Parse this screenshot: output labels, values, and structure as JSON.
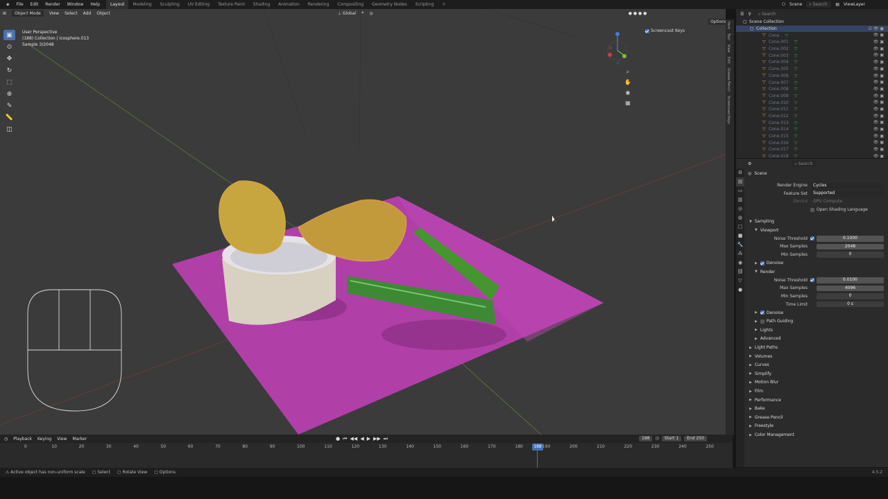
{
  "menu": [
    "File",
    "Edit",
    "Render",
    "Window",
    "Help"
  ],
  "workspaces": [
    "Layout",
    "Modeling",
    "Sculpting",
    "UV Editing",
    "Texture Paint",
    "Shading",
    "Animation",
    "Rendering",
    "Compositing",
    "Geometry Nodes",
    "Scripting"
  ],
  "active_workspace": "Layout",
  "topbar": {
    "scene": "Scene",
    "viewlayer": "ViewLayer",
    "search_placeholder": "Search"
  },
  "viewport": {
    "mode": "Object Mode",
    "menus": [
      "View",
      "Select",
      "Add",
      "Object"
    ],
    "orientation": "Global",
    "options": "Options",
    "perspective": "User Perspective",
    "collection": "(188) Collection | Icosphere.013",
    "sample": "Sample 3/2048",
    "screencast_keys": "Screencast Keys",
    "side_tabs": [
      "Item",
      "Tool",
      "View",
      "Edit",
      "Grease Pencil",
      "Screencast Keys"
    ]
  },
  "outliner": {
    "scene_collection": "Scene Collection",
    "collection": "Collection",
    "items": [
      "Cone",
      "Cone.001",
      "Cone.002",
      "Cone.003",
      "Cone.004",
      "Cone.005",
      "Cone.006",
      "Cone.007",
      "Cone.008",
      "Cone.009",
      "Cone.010",
      "Cone.011",
      "Cone.012",
      "Cone.013",
      "Cone.014",
      "Cone.015",
      "Cone.016",
      "Cone.017",
      "Cone.018"
    ]
  },
  "properties": {
    "context": "Scene",
    "search_placeholder": "Search",
    "render_engine": {
      "label": "Render Engine",
      "value": "Cycles"
    },
    "feature_set": {
      "label": "Feature Set",
      "value": "Supported"
    },
    "device": {
      "label": "Device",
      "value": "GPU Compute"
    },
    "osl": "Open Shading Language",
    "sampling": "Sampling",
    "viewport": "Viewport",
    "vp_noise_threshold": {
      "label": "Noise Threshold",
      "value": "0.1000"
    },
    "vp_max_samples": {
      "label": "Max Samples",
      "value": "2048"
    },
    "vp_min_samples": {
      "label": "Min Samples",
      "value": "0"
    },
    "denoise1": "Denoise",
    "render": "Render",
    "r_noise_threshold": {
      "label": "Noise Threshold",
      "value": "0.0100"
    },
    "r_max_samples": {
      "label": "Max Samples",
      "value": "4096"
    },
    "r_min_samples": {
      "label": "Min Samples",
      "value": "0"
    },
    "r_time_limit": {
      "label": "Time Limit",
      "value": "0 s"
    },
    "denoise2": "Denoise",
    "path_guiding": "Path Guiding",
    "lights": "Lights",
    "advanced": "Advanced",
    "sections": [
      "Light Paths",
      "Volumes",
      "Curves",
      "Simplify",
      "Motion Blur",
      "Film",
      "Performance",
      "Bake",
      "Grease Pencil",
      "Freestyle",
      "Color Management"
    ]
  },
  "timeline": {
    "menus": [
      "Playback",
      "Keying",
      "View",
      "Marker"
    ],
    "current_frame": "188",
    "start_label": "Start",
    "start": "1",
    "end_label": "End",
    "end": "250",
    "ticks": [
      "0",
      "10",
      "20",
      "30",
      "40",
      "50",
      "60",
      "70",
      "80",
      "90",
      "100",
      "110",
      "120",
      "130",
      "140",
      "150",
      "160",
      "170",
      "180",
      "190",
      "200",
      "210",
      "220",
      "230",
      "240",
      "250"
    ]
  },
  "status": {
    "message": "Active object has non-uniform scale",
    "select": "Select",
    "rotate": "Rotate View",
    "options": "Options",
    "version": "4.5.2"
  },
  "colors": {
    "accent": "#4772b3",
    "plane": "#b03fa8",
    "grass": "#3e8a34",
    "ginger": "#c7a63f"
  }
}
